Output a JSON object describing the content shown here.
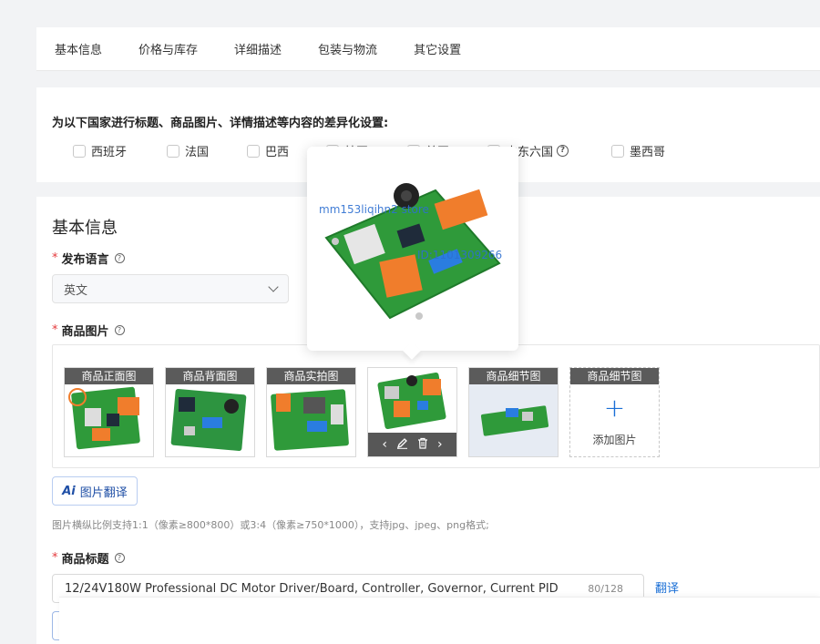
{
  "tabs": [
    "基本信息",
    "价格与库存",
    "详细描述",
    "包装与物流",
    "其它设置"
  ],
  "country_section": {
    "title": "为以下国家进行标题、商品图片、详情描述等内容的差异化设置:",
    "options": [
      {
        "label": "西班牙",
        "checked": false
      },
      {
        "label": "法国",
        "checked": false
      },
      {
        "label": "巴西",
        "checked": false
      },
      {
        "label": "韩国",
        "checked": false
      },
      {
        "label": "美国",
        "checked": false
      },
      {
        "label": "中东六国",
        "checked": false,
        "help": true
      },
      {
        "label": "墨西哥",
        "checked": false
      }
    ]
  },
  "basic_info": {
    "heading": "基本信息",
    "language": {
      "label": "发布语言",
      "value": "英文"
    },
    "images": {
      "label": "商品图片",
      "slots": [
        {
          "caption": "商品正面图"
        },
        {
          "caption": "商品背面图"
        },
        {
          "caption": "商品实拍图"
        },
        {
          "caption": ""
        },
        {
          "caption": "商品细节图"
        },
        {
          "caption": "商品细节图",
          "add_label": "添加图片"
        }
      ],
      "hover_toolbar": {
        "prev": "‹",
        "edit": "edit-icon",
        "delete": "trash-icon",
        "next": "›"
      },
      "translate_button": "图片翻译",
      "translate_badge": "Ai",
      "hint": "图片横纵比例支持1:1（像素≥800*800）或3:4（像素≥750*1000），支持jpg、jpeg、png格式;"
    },
    "title_field": {
      "label": "商品标题",
      "value": "12/24V180W Professional DC Motor Driver/Board, Controller, Governor, Current PID",
      "counter": "80/128",
      "translate": "翻译"
    }
  },
  "popup": {
    "watermark_1": "mm153liqihn2 store",
    "watermark_2": "ID:1101309266"
  },
  "colors": {
    "accent": "#1a6fd6",
    "required": "#e4393c",
    "caption_bg": "#5b5b5b",
    "pcb_green": "#2f9a3a",
    "terminal_orange": "#f07d2c"
  }
}
